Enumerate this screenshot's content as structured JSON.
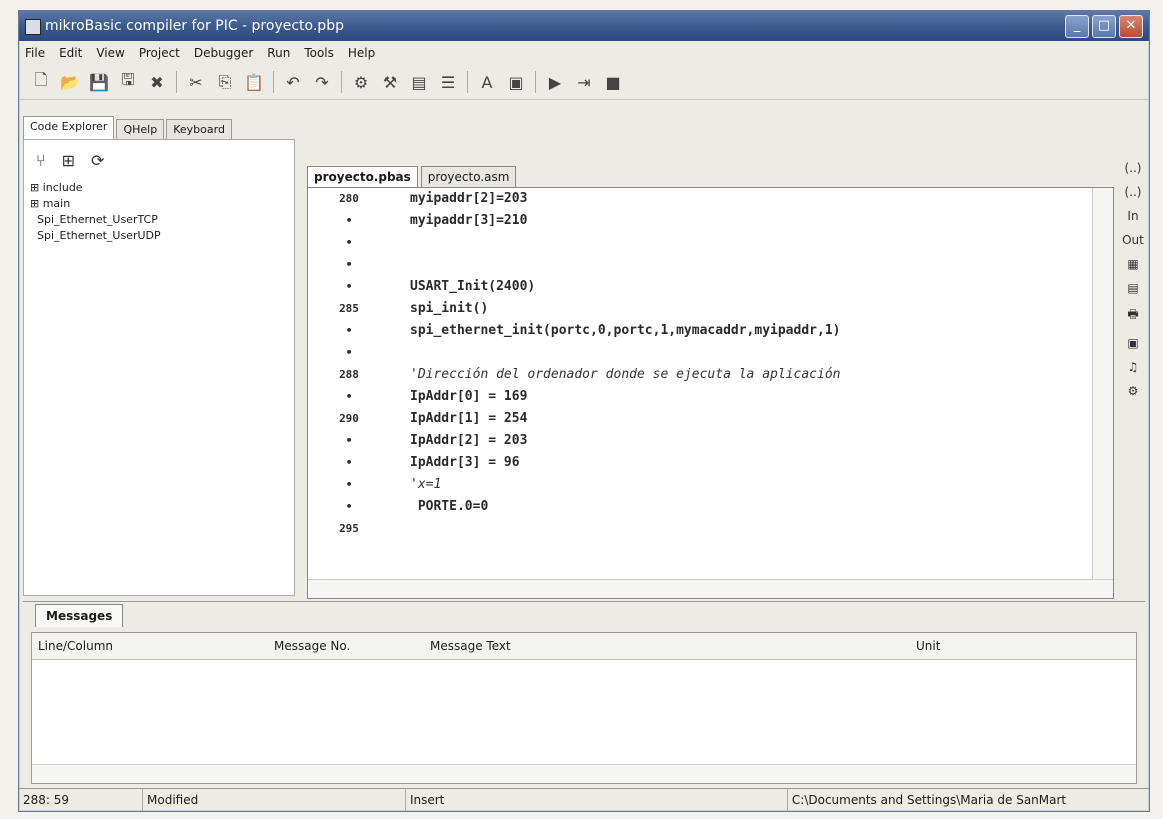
{
  "window": {
    "title": "mikroBasic compiler for PIC - proyecto.pbp"
  },
  "menu": [
    "File",
    "Edit",
    "View",
    "Project",
    "Debugger",
    "Run",
    "Tools",
    "Help"
  ],
  "left_tabs": [
    "Code Explorer",
    "QHelp",
    "Keyboard"
  ],
  "tree": [
    "include",
    "main",
    "Spi_Ethernet_UserTCP",
    "Spi_Ethernet_UserUDP"
  ],
  "editor_tabs": [
    "proyecto.pbas",
    "proyecto.asm"
  ],
  "gutter": [
    "280",
    "•",
    "•",
    "•",
    "•",
    "285",
    "•",
    "•",
    "288",
    "•",
    "290",
    "•",
    "•",
    "•",
    "•",
    "295"
  ],
  "code": [
    "myipaddr[2]=203",
    "myipaddr[3]=210",
    "",
    "",
    "USART_Init(2400)",
    "spi_init()",
    "spi_ethernet_init(portc,0,portc,1,mymacaddr,myipaddr,1)",
    "",
    "'Dirección del ordenador donde se ejecuta la aplicación",
    "IpAddr[0] = 169",
    "IpAddr[1] = 254",
    "IpAddr[2] = 203",
    "IpAddr[3] = 96",
    "'x=1",
    " PORTE.0=0",
    ""
  ],
  "right_tools": [
    "(..)",
    "(..)",
    "In",
    "Out"
  ],
  "messages": {
    "tab": "Messages",
    "columns": [
      "Line/Column",
      "Message No.",
      "Message Text",
      "Unit"
    ]
  },
  "status": {
    "position": "288: 59",
    "state": "Modified",
    "mode": "Insert",
    "path": "C:\\Documents and Settings\\Maria de SanMart"
  }
}
